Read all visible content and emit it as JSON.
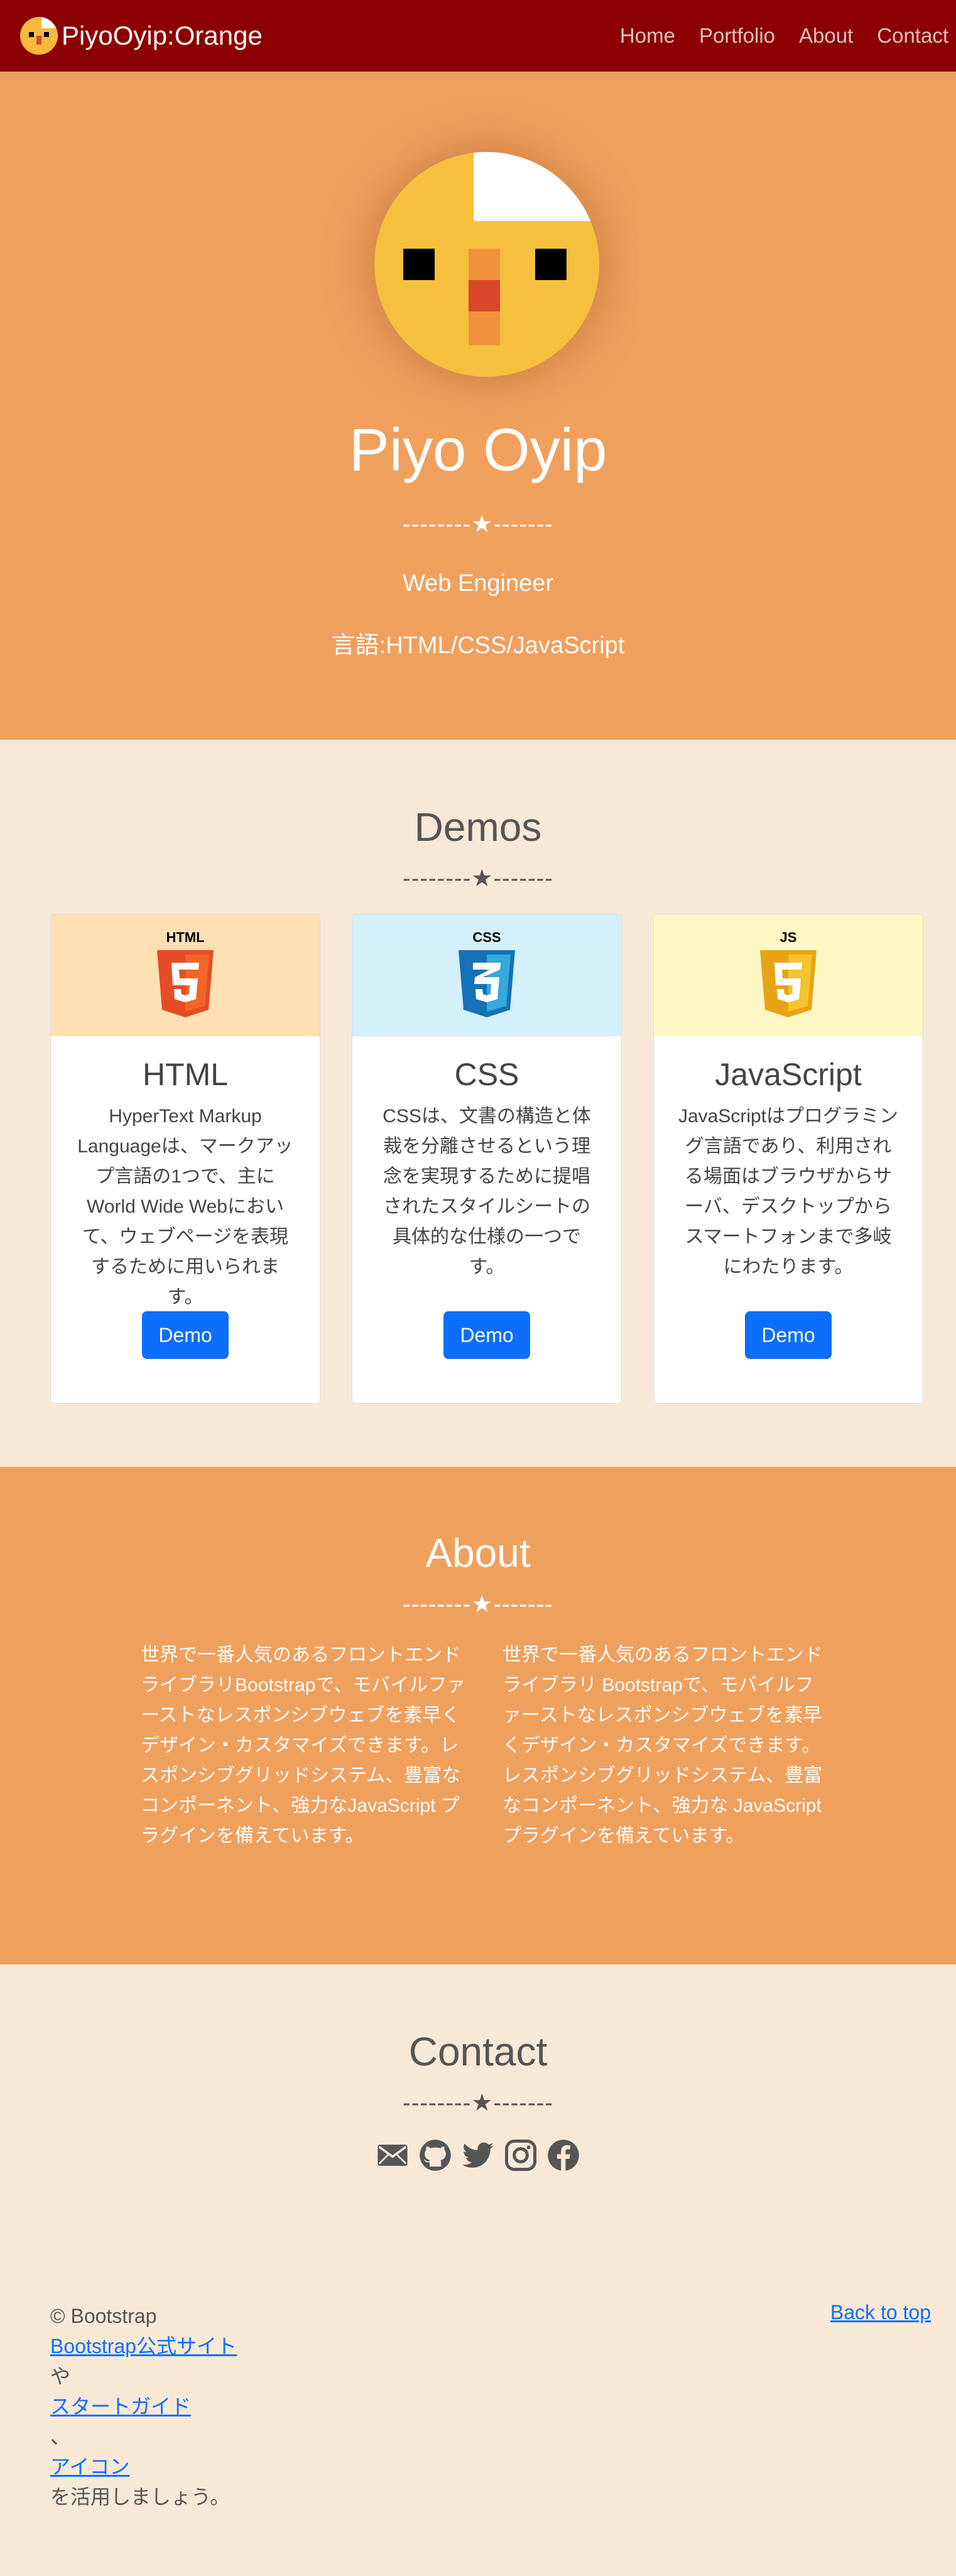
{
  "nav": {
    "brand": "PiyoOyip:Orange",
    "links": [
      "Home",
      "Portfolio",
      "About",
      "Contact"
    ]
  },
  "hero": {
    "name": "Piyo Oyip",
    "divider": "--------★-------",
    "role": "Web Engineer",
    "languages": "言語:HTML/CSS/JavaScript"
  },
  "demos": {
    "title": "Demos",
    "divider": "--------★-------",
    "cards": [
      {
        "title": "HTML",
        "icon": "html5-icon",
        "bg": "#ffe0b3",
        "text": "HyperText Markup Languageは、マークアップ言語の1つで、主にWorld Wide Webにおいて、ウェブページを表現するために用いられます。",
        "button": "Demo"
      },
      {
        "title": "CSS",
        "icon": "css3-icon",
        "bg": "#d3f0fb",
        "text": "CSSは、文書の構造と体裁を分離させるという理念を実現するために提唱されたスタイルシートの具体的な仕様の一つです。",
        "button": "Demo"
      },
      {
        "title": "JavaScript",
        "icon": "js-icon",
        "bg": "#fff8c5",
        "text": "JavaScriptはプログラミング言語であり、利用される場面はブラウザからサーバ、デスクトップからスマートフォンまで多岐にわたります。",
        "button": "Demo"
      }
    ]
  },
  "about": {
    "title": "About",
    "divider": "--------★-------",
    "col1": "世界で一番人気のあるフロントエンドライブラリBootstrapで、モバイルファーストなレスポンシブウェブを素早くデザイン・カスタマイズできます。レスポンシブグリッドシステム、豊富なコンポーネント、強力なJavaScript プラグインを備えています。",
    "col2": "世界で一番人気のあるフロントエンドライブラリ Bootstrapで、モバイルファーストなレスポンシブウェブを素早くデザイン・カスタマイズできます。レスポンシブグリッドシステム、豊富なコンポーネント、強力な JavaScript プラグインを備えています。"
  },
  "contact": {
    "title": "Contact",
    "divider": "--------★-------",
    "icons": [
      "mail-icon",
      "github-icon",
      "twitter-icon",
      "instagram-icon",
      "facebook-icon"
    ]
  },
  "footer": {
    "copyright": "© Bootstrap",
    "link1": "Bootstrap公式サイト",
    "sep1": "や",
    "link2": "スタートガイド",
    "sep2": "、",
    "link3": "アイコン",
    "tail": "を活用しましょう。",
    "back_to_top": "Back to top"
  }
}
